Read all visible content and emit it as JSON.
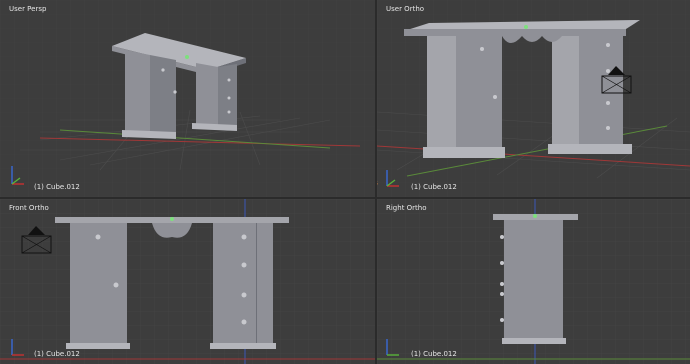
{
  "viewports": {
    "top_left": {
      "title": "User Persp",
      "status": "(1) Cube.012"
    },
    "top_right": {
      "title": "User Ortho",
      "status": "(1) Cube.012"
    },
    "bottom_left": {
      "title": "Front Ortho",
      "status": "(1) Cube.012"
    },
    "bottom_right": {
      "title": "Right Ortho",
      "status": "(1) Cube.012"
    }
  },
  "colors": {
    "viewport_bg": "#3d3d3d",
    "grid_line": "#474747",
    "axis_x": "#a03838",
    "axis_y": "#5a8a3a",
    "mesh_face": "#8f9097",
    "mesh_dark": "#6e7078",
    "mesh_light": "#b4b5bb",
    "selection_dot": "#7de07d"
  },
  "icons": [
    "camera-icon",
    "3d-cursor-icon",
    "axis-gizmo-icon"
  ]
}
